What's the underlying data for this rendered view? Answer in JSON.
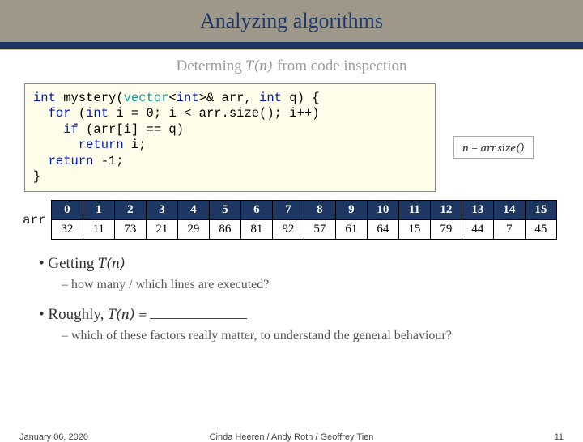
{
  "title": "Analyzing algorithms",
  "subtitle_pre": "Determing ",
  "subtitle_tn": "T(n)",
  "subtitle_post": " from code inspection",
  "code": {
    "l1a": "int",
    "l1b": " mystery(",
    "l1c": "vector",
    "l1d": "<",
    "l1e": "int",
    "l1f": ">& arr, ",
    "l1g": "int",
    "l1h": " q) {",
    "l2a": "  for",
    "l2b": " (",
    "l2c": "int",
    "l2d": " i = 0; i < arr.size(); i++)",
    "l3a": "    if",
    "l3b": " (arr[i] == q)",
    "l4a": "      return",
    "l4b": " i;",
    "l5a": "  return",
    "l5b": " -1;",
    "l6": "}"
  },
  "formula": "n = arr.size()",
  "arr_label": "arr",
  "indices": [
    "0",
    "1",
    "2",
    "3",
    "4",
    "5",
    "6",
    "7",
    "8",
    "9",
    "10",
    "11",
    "12",
    "13",
    "14",
    "15"
  ],
  "values": [
    "32",
    "11",
    "73",
    "21",
    "29",
    "86",
    "81",
    "92",
    "57",
    "61",
    "64",
    "15",
    "79",
    "44",
    "7",
    "45"
  ],
  "bullets": {
    "b1_pre": "Getting ",
    "b1_tn": "T(n)",
    "b1_sub": "how many / which lines are executed?",
    "b2_pre": "Roughly, ",
    "b2_tn": "T(n) = ",
    "b2_sub": "which of these factors really matter, to understand the general behaviour?"
  },
  "footer": {
    "date": "January 06, 2020",
    "credits": "Cinda Heeren / Andy Roth / Geoffrey Tien",
    "page": "11"
  },
  "chart_data": {
    "type": "table",
    "title": "arr contents",
    "categories": [
      0,
      1,
      2,
      3,
      4,
      5,
      6,
      7,
      8,
      9,
      10,
      11,
      12,
      13,
      14,
      15
    ],
    "values": [
      32,
      11,
      73,
      21,
      29,
      86,
      81,
      92,
      57,
      61,
      64,
      15,
      79,
      44,
      7,
      45
    ]
  }
}
